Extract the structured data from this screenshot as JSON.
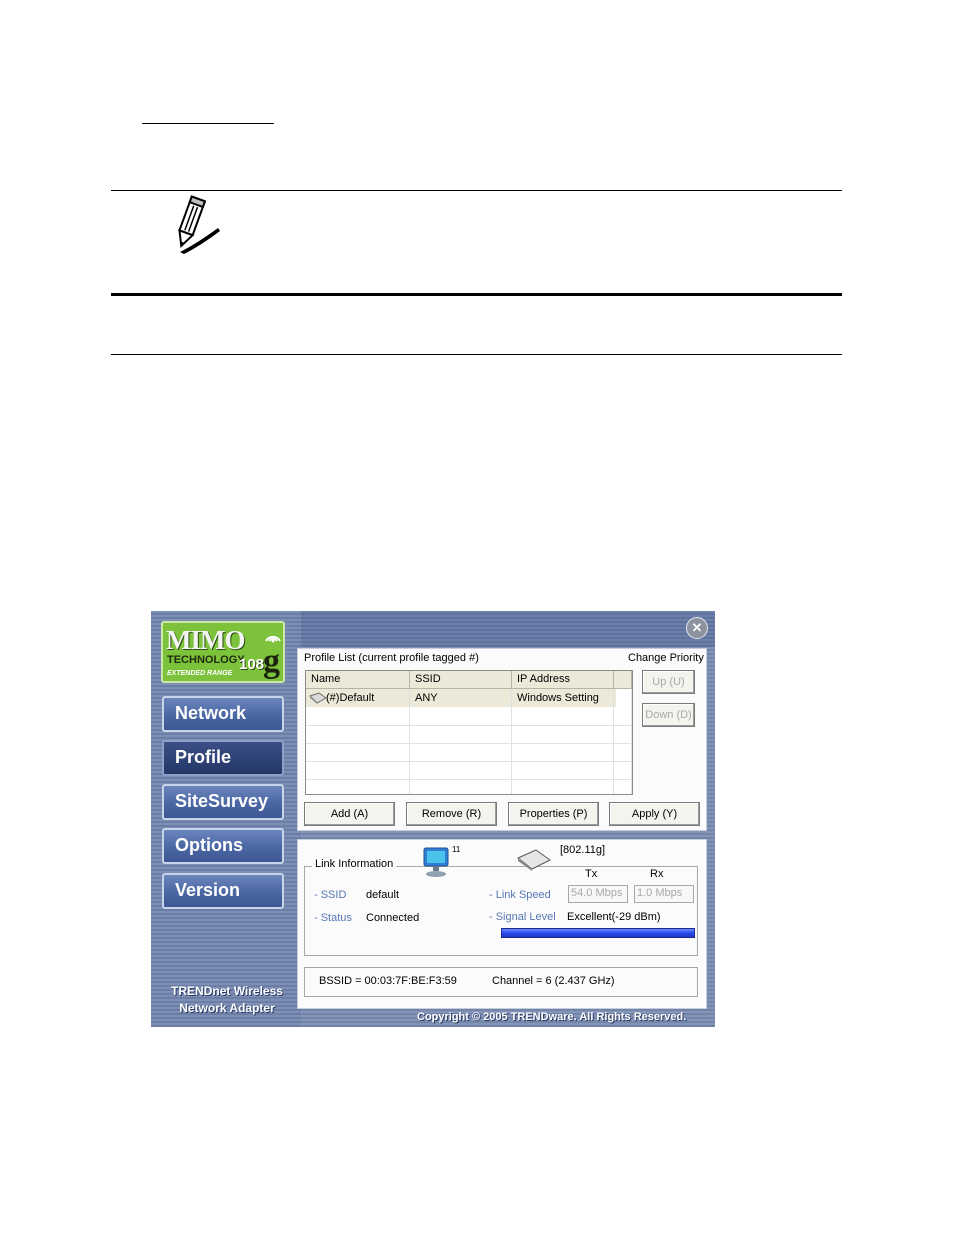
{
  "window": {
    "logo": {
      "mimo": "MIMO",
      "technology": "TECHNOLOGY",
      "extended": "EXTENDED RANGE",
      "n108": "108",
      "g": "g"
    },
    "nav": [
      "Network",
      "Profile",
      "SiteSurvey",
      "Options",
      "Version"
    ],
    "active_nav": "Profile",
    "brand_line1": "TRENDnet Wireless",
    "brand_line2": "Network Adapter",
    "copyright": "Copyright © 2005 TRENDware. All Rights Reserved.",
    "close_icon": "close-icon"
  },
  "profile": {
    "list_title": "Profile List (current profile tagged #)",
    "change_priority": "Change Priority",
    "columns": [
      "Name",
      "SSID",
      "IP Address"
    ],
    "rows": [
      {
        "name": "(#)Default",
        "ssid": "ANY",
        "ip": "Windows Setting"
      }
    ],
    "up_label": "Up (U)",
    "down_label": "Down (D)",
    "add_label": "Add (A)",
    "remove_label": "Remove (R)",
    "properties_label": "Properties (P)",
    "apply_label": "Apply (Y)"
  },
  "link": {
    "title": "Link Information",
    "signal_badge": "11",
    "mode": "[802.11g]",
    "ssid_label": "- SSID",
    "ssid_value": "default",
    "status_label": "- Status",
    "status_value": "Connected",
    "tx_label": "Tx",
    "rx_label": "Rx",
    "link_speed_label": "- Link Speed",
    "tx_speed": "54.0 Mbps",
    "rx_speed": "1.0 Mbps",
    "signal_level_label": "- Signal Level",
    "signal_level_value": "Excellent(-29 dBm)",
    "signal_percent": 100,
    "bssid": "BSSID = 00:03:7F:BE:F3:59",
    "channel": "Channel = 6 (2.437 GHz)"
  }
}
